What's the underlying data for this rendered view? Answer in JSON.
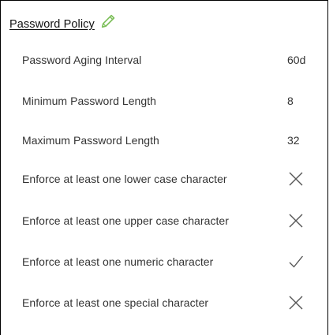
{
  "section": {
    "title": "Password Policy",
    "edit_icon": "pencil-icon",
    "accent_color": "#7dbf5a"
  },
  "policies": [
    {
      "label": "Password Aging Interval",
      "value": "60d"
    },
    {
      "label": "Minimum Password Length",
      "value": "8"
    },
    {
      "label": "Maximum Password Length",
      "value": "32"
    },
    {
      "label": "Enforce at least one lower case character",
      "status": "disabled",
      "icon": "x-icon"
    },
    {
      "label": "Enforce at least one upper case character",
      "status": "disabled",
      "icon": "x-icon"
    },
    {
      "label": "Enforce at least one numeric character",
      "status": "enabled",
      "icon": "check-icon"
    },
    {
      "label": "Enforce at least one special character",
      "status": "disabled",
      "icon": "x-icon"
    }
  ]
}
